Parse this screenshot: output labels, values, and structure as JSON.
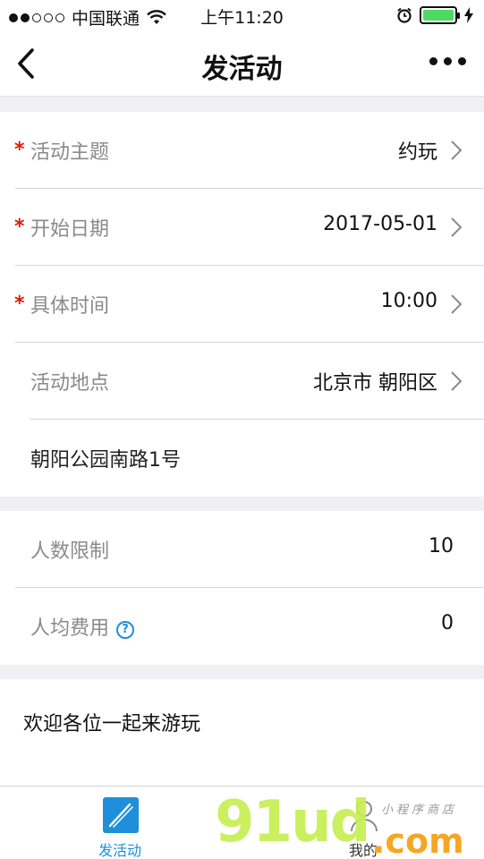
{
  "status_bar": {
    "carrier": "中国联通",
    "time": "上午11:20",
    "signal_icon": "signal-dots-icon",
    "wifi_icon": "wifi-icon",
    "alarm_icon": "alarm-clock-icon",
    "battery_icon": "battery-icon",
    "charging_icon": "lightning-icon",
    "battery_color": "#4cd964"
  },
  "nav": {
    "title": "发活动",
    "back_icon": "chevron-left-icon",
    "more_icon": "more-dots-icon"
  },
  "form": {
    "required_mark": "*",
    "rows": [
      {
        "label": "活动主题",
        "value": "约玩",
        "required": true
      },
      {
        "label": "开始日期",
        "value": "2017-05-01",
        "required": true
      },
      {
        "label": "具体时间",
        "value": "10:00",
        "required": true
      },
      {
        "label": "活动地点",
        "value": "北京市 朝阳区",
        "required": false
      }
    ],
    "address": "朝阳公园南路1号",
    "limit": {
      "label": "人数限制",
      "value": "10"
    },
    "fee": {
      "label": "人均费用",
      "value": "0",
      "help_glyph": "?"
    },
    "description": "欢迎各位一起来游玩"
  },
  "tabs": [
    {
      "label": "发活动",
      "icon": "pen-icon",
      "active": true
    },
    {
      "label": "我的",
      "icon": "user-icon",
      "active": false
    }
  ],
  "watermark": {
    "big": "91ud",
    "com": ".com",
    "small": "小程序商店"
  },
  "colors": {
    "accent": "#1e8fd8",
    "required": "#d81e06",
    "background": "#efeff4"
  }
}
